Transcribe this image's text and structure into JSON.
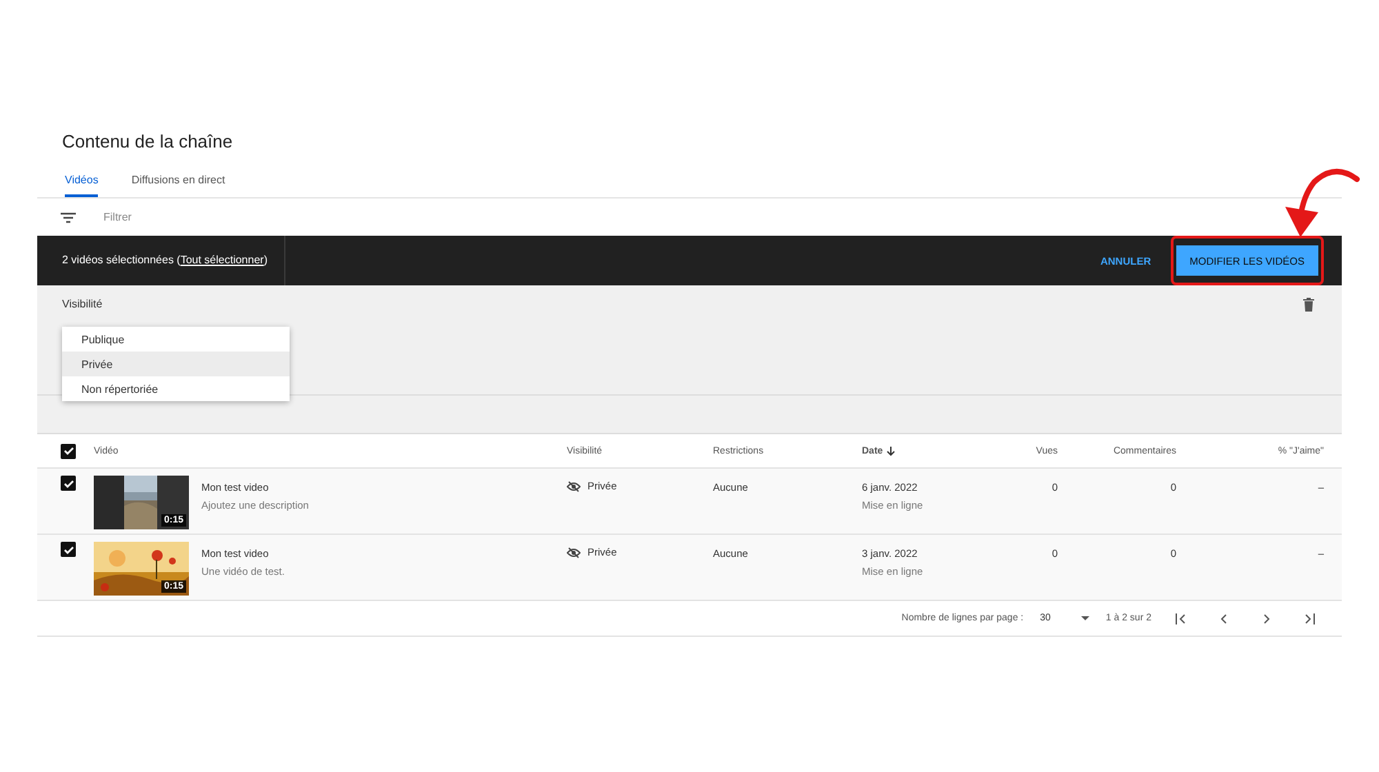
{
  "page_title": "Contenu de la chaîne",
  "tabs": [
    {
      "label": "Vidéos",
      "selected": true
    },
    {
      "label": "Diffusions en direct",
      "selected": false
    }
  ],
  "filter": {
    "placeholder": "Filtrer"
  },
  "selection_bar": {
    "count_text": "2 vidéos sélectionnées (",
    "link": "Tout sélectionner",
    "close_text": ")",
    "cancel": "ANNULER",
    "edit": "MODIFIER LES VIDÉOS"
  },
  "edit_panel": {
    "label": "Visibilité",
    "options": [
      {
        "label": "Publique",
        "selected": false
      },
      {
        "label": "Privée",
        "selected": true
      },
      {
        "label": "Non répertoriée",
        "selected": false
      }
    ]
  },
  "table": {
    "all_checked": true,
    "columns": [
      "Vidéo",
      "Visibilité",
      "Restrictions",
      "Date",
      "Vues",
      "Commentaires",
      "% \"J'aime\""
    ],
    "rows": [
      {
        "checked": true,
        "duration": "0:15",
        "title": "Mon test video",
        "description": "Ajoutez une description",
        "visibility": "Privée",
        "restrictions": "Aucune",
        "date": "6 janv. 2022",
        "date_note": "Mise en ligne",
        "views": "0",
        "comments": "0",
        "likes": "–"
      },
      {
        "checked": true,
        "duration": "0:15",
        "title": "Mon test video",
        "description": "Une vidéo de test.",
        "visibility": "Privée",
        "restrictions": "Aucune",
        "date": "3 janv. 2022",
        "date_note": "Mise en ligne",
        "views": "0",
        "comments": "0",
        "likes": "–"
      }
    ]
  },
  "pagination": {
    "rows_label": "Nombre de lignes par page :",
    "rows_value": "30",
    "range": "1 à 2 sur 2"
  }
}
